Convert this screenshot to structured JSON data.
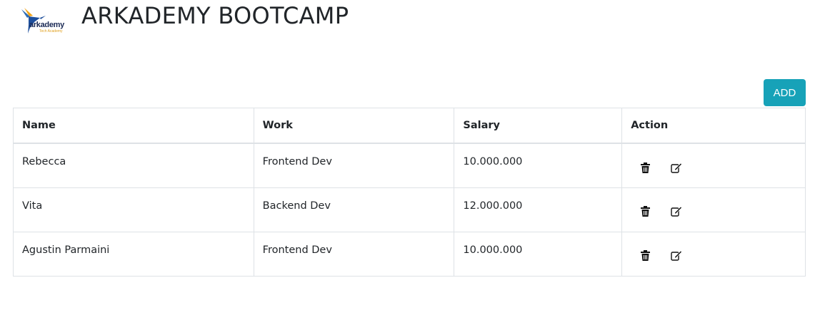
{
  "header": {
    "logo_brand": "arkademy",
    "logo_tagline": "Tech Academy",
    "title": "ARKADEMY BOOTCAMP"
  },
  "toolbar": {
    "add_label": "ADD",
    "add_color": "#17a2b8"
  },
  "table": {
    "columns": [
      "Name",
      "Work",
      "Salary",
      "Action"
    ],
    "rows": [
      {
        "name": "Rebecca",
        "work": "Frontend Dev",
        "salary": "10.000.000"
      },
      {
        "name": "Vita",
        "work": "Backend Dev",
        "salary": "12.000.000"
      },
      {
        "name": "Agustin Parmaini",
        "work": "Frontend Dev",
        "salary": "10.000.000"
      }
    ],
    "row_actions": [
      "trash-icon",
      "edit-icon"
    ]
  }
}
